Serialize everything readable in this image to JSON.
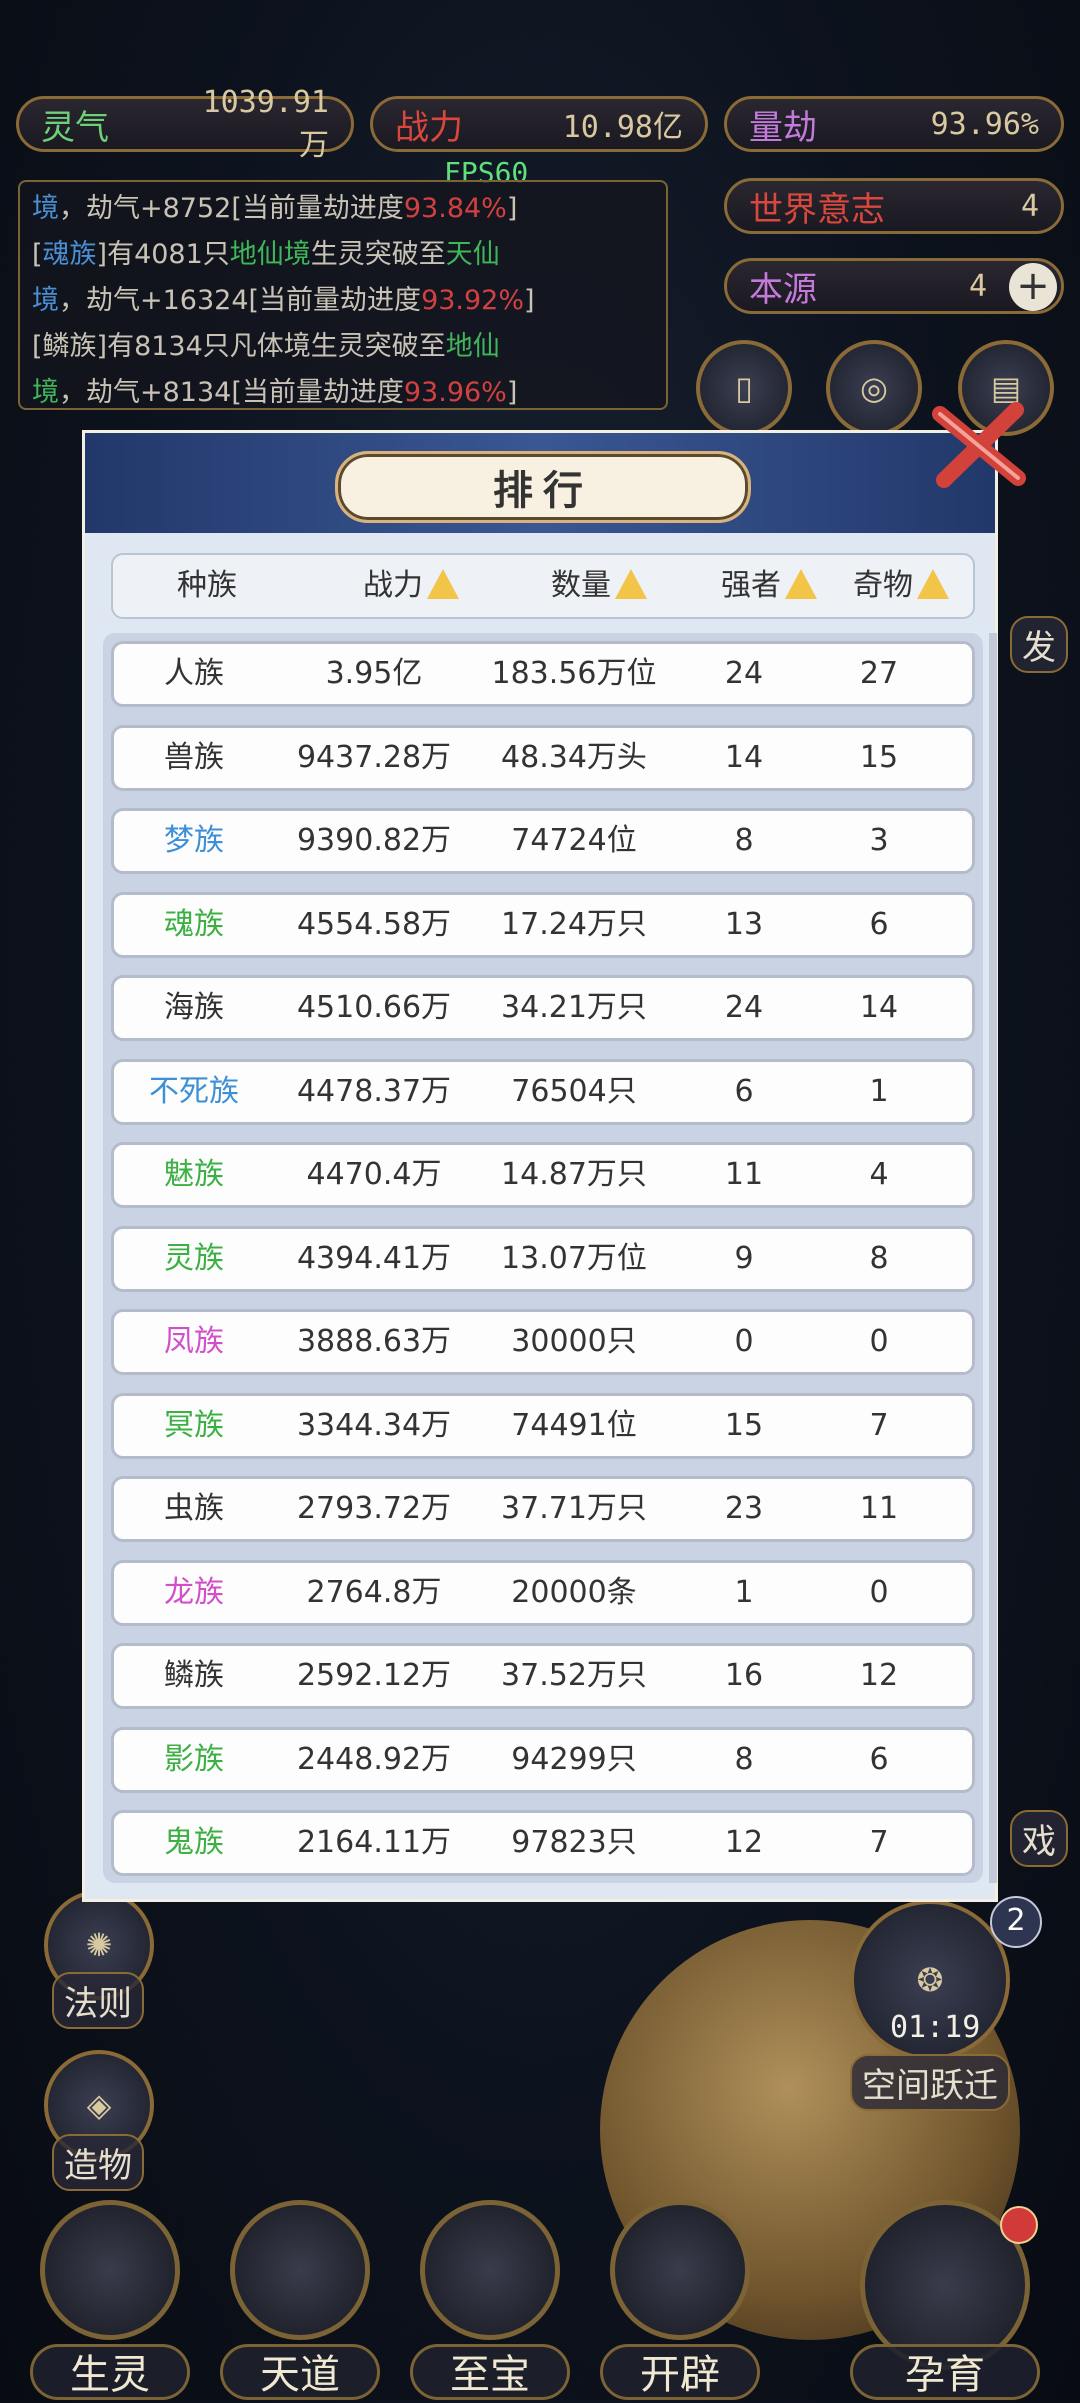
{
  "resources": {
    "lingqi": {
      "label": "灵气",
      "value": "1039.91万"
    },
    "zhanli": {
      "label": "战力",
      "value": "10.98亿"
    },
    "liangjie": {
      "label": "量劫",
      "value": "93.96%"
    },
    "world_will": {
      "label": "世界意志",
      "value": "4"
    },
    "benyuan": {
      "label": "本源",
      "value": "4"
    }
  },
  "fps": "FPS60",
  "log_lines": [
    [
      {
        "t": "境",
        "c": "b"
      },
      {
        "t": "，劫气+8752[当前量劫进度"
      },
      {
        "t": "93.84%",
        "c": "r"
      },
      {
        "t": "]"
      }
    ],
    [
      {
        "t": "["
      },
      {
        "t": "魂族",
        "c": "b"
      },
      {
        "t": "]有4081只"
      },
      {
        "t": "地仙境",
        "c": "g"
      },
      {
        "t": "生灵突破至"
      },
      {
        "t": "天仙",
        "c": "g"
      }
    ],
    [
      {
        "t": "境",
        "c": "b"
      },
      {
        "t": "，劫气+16324[当前量劫进度"
      },
      {
        "t": "93.92%",
        "c": "r"
      },
      {
        "t": "]"
      }
    ],
    [
      {
        "t": "[鳞族]有8134只凡体境生灵突破至"
      },
      {
        "t": "地仙",
        "c": "g"
      }
    ],
    [
      {
        "t": "境",
        "c": "g"
      },
      {
        "t": "，劫气+8134[当前量劫进度"
      },
      {
        "t": "93.96%",
        "c": "r"
      },
      {
        "t": "]"
      }
    ]
  ],
  "side_labels": {
    "fa": "发",
    "xi": "戏",
    "faze": "法则",
    "zaowu": "造物",
    "kongjian": "空间跃迁",
    "timer": "01:19",
    "badge": "2"
  },
  "bottom_nav": [
    "生灵",
    "天道",
    "至宝",
    "开辟",
    "孕育"
  ],
  "ranking": {
    "title": "排行",
    "headers": [
      "种族",
      "战力",
      "数量",
      "强者",
      "奇物"
    ],
    "rows": [
      {
        "race": "人族",
        "color": "#333333",
        "power": "3.95亿",
        "count": "183.56万位",
        "strong": "24",
        "items": "27"
      },
      {
        "race": "兽族",
        "color": "#333333",
        "power": "9437.28万",
        "count": "48.34万头",
        "strong": "14",
        "items": "15"
      },
      {
        "race": "梦族",
        "color": "#3d8fd6",
        "power": "9390.82万",
        "count": "74724位",
        "strong": "8",
        "items": "3"
      },
      {
        "race": "魂族",
        "color": "#3cb043",
        "power": "4554.58万",
        "count": "17.24万只",
        "strong": "13",
        "items": "6"
      },
      {
        "race": "海族",
        "color": "#333333",
        "power": "4510.66万",
        "count": "34.21万只",
        "strong": "24",
        "items": "14"
      },
      {
        "race": "不死族",
        "color": "#3d8fd6",
        "power": "4478.37万",
        "count": "76504只",
        "strong": "6",
        "items": "1"
      },
      {
        "race": "魅族",
        "color": "#3cb043",
        "power": "4470.4万",
        "count": "14.87万只",
        "strong": "11",
        "items": "4"
      },
      {
        "race": "灵族",
        "color": "#3cb043",
        "power": "4394.41万",
        "count": "13.07万位",
        "strong": "9",
        "items": "8"
      },
      {
        "race": "凤族",
        "color": "#d14fc9",
        "power": "3888.63万",
        "count": "30000只",
        "strong": "0",
        "items": "0"
      },
      {
        "race": "冥族",
        "color": "#3cb043",
        "power": "3344.34万",
        "count": "74491位",
        "strong": "15",
        "items": "7"
      },
      {
        "race": "虫族",
        "color": "#333333",
        "power": "2793.72万",
        "count": "37.71万只",
        "strong": "23",
        "items": "11"
      },
      {
        "race": "龙族",
        "color": "#d14fc9",
        "power": "2764.8万",
        "count": "20000条",
        "strong": "1",
        "items": "0"
      },
      {
        "race": "鳞族",
        "color": "#333333",
        "power": "2592.12万",
        "count": "37.52万只",
        "strong": "16",
        "items": "12"
      },
      {
        "race": "影族",
        "color": "#3cb043",
        "power": "2448.92万",
        "count": "94299只",
        "strong": "8",
        "items": "6"
      },
      {
        "race": "鬼族",
        "color": "#3cb043",
        "power": "2164.11万",
        "count": "97823只",
        "strong": "12",
        "items": "7"
      }
    ]
  }
}
